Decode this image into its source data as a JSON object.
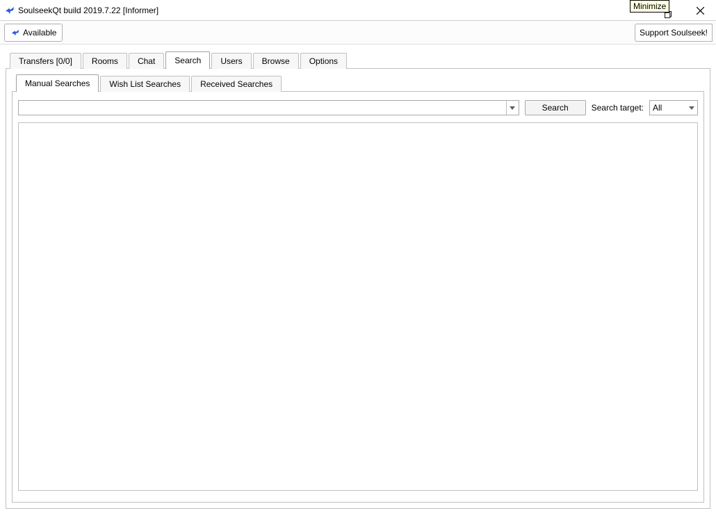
{
  "tooltip": "Minimize",
  "title": "SoulseekQt build 2019.7.22 [Informer]",
  "toolbar": {
    "available_label": "Available",
    "support_label": "Support Soulseek!"
  },
  "main_tabs": {
    "items": [
      {
        "label": "Transfers [0/0]"
      },
      {
        "label": "Rooms"
      },
      {
        "label": "Chat"
      },
      {
        "label": "Search"
      },
      {
        "label": "Users"
      },
      {
        "label": "Browse"
      },
      {
        "label": "Options"
      }
    ],
    "active_index": 3
  },
  "search_tabs": {
    "items": [
      {
        "label": "Manual Searches"
      },
      {
        "label": "Wish List Searches"
      },
      {
        "label": "Received Searches"
      }
    ],
    "active_index": 0
  },
  "search": {
    "input_value": "",
    "button_label": "Search",
    "target_label": "Search target:",
    "target_value": "All"
  }
}
